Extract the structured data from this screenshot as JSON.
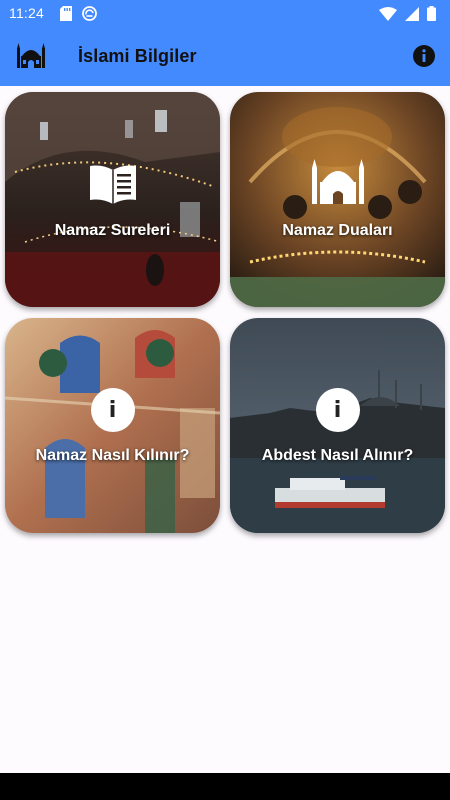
{
  "status_bar": {
    "time": "11:24",
    "icons": [
      "sd-card-icon",
      "sync-icon",
      "wifi-icon",
      "signal-icon",
      "battery-icon"
    ]
  },
  "app_bar": {
    "logo_icon": "mosque-icon",
    "title": "İslami Bilgiler",
    "info_icon": "info-icon"
  },
  "cards": [
    {
      "label": "Namaz Sureleri",
      "icon": "book-icon"
    },
    {
      "label": "Namaz Duaları",
      "icon": "mosque-icon"
    },
    {
      "label": "Namaz Nasıl Kılınır?",
      "icon": "info-icon",
      "icon_glyph": "i"
    },
    {
      "label": "Abdest Nasıl Alınır?",
      "icon": "info-icon",
      "icon_glyph": "i"
    }
  ],
  "colors": {
    "primary": "#448aff",
    "background": "#fefbff",
    "nav_bar": "#000000"
  }
}
